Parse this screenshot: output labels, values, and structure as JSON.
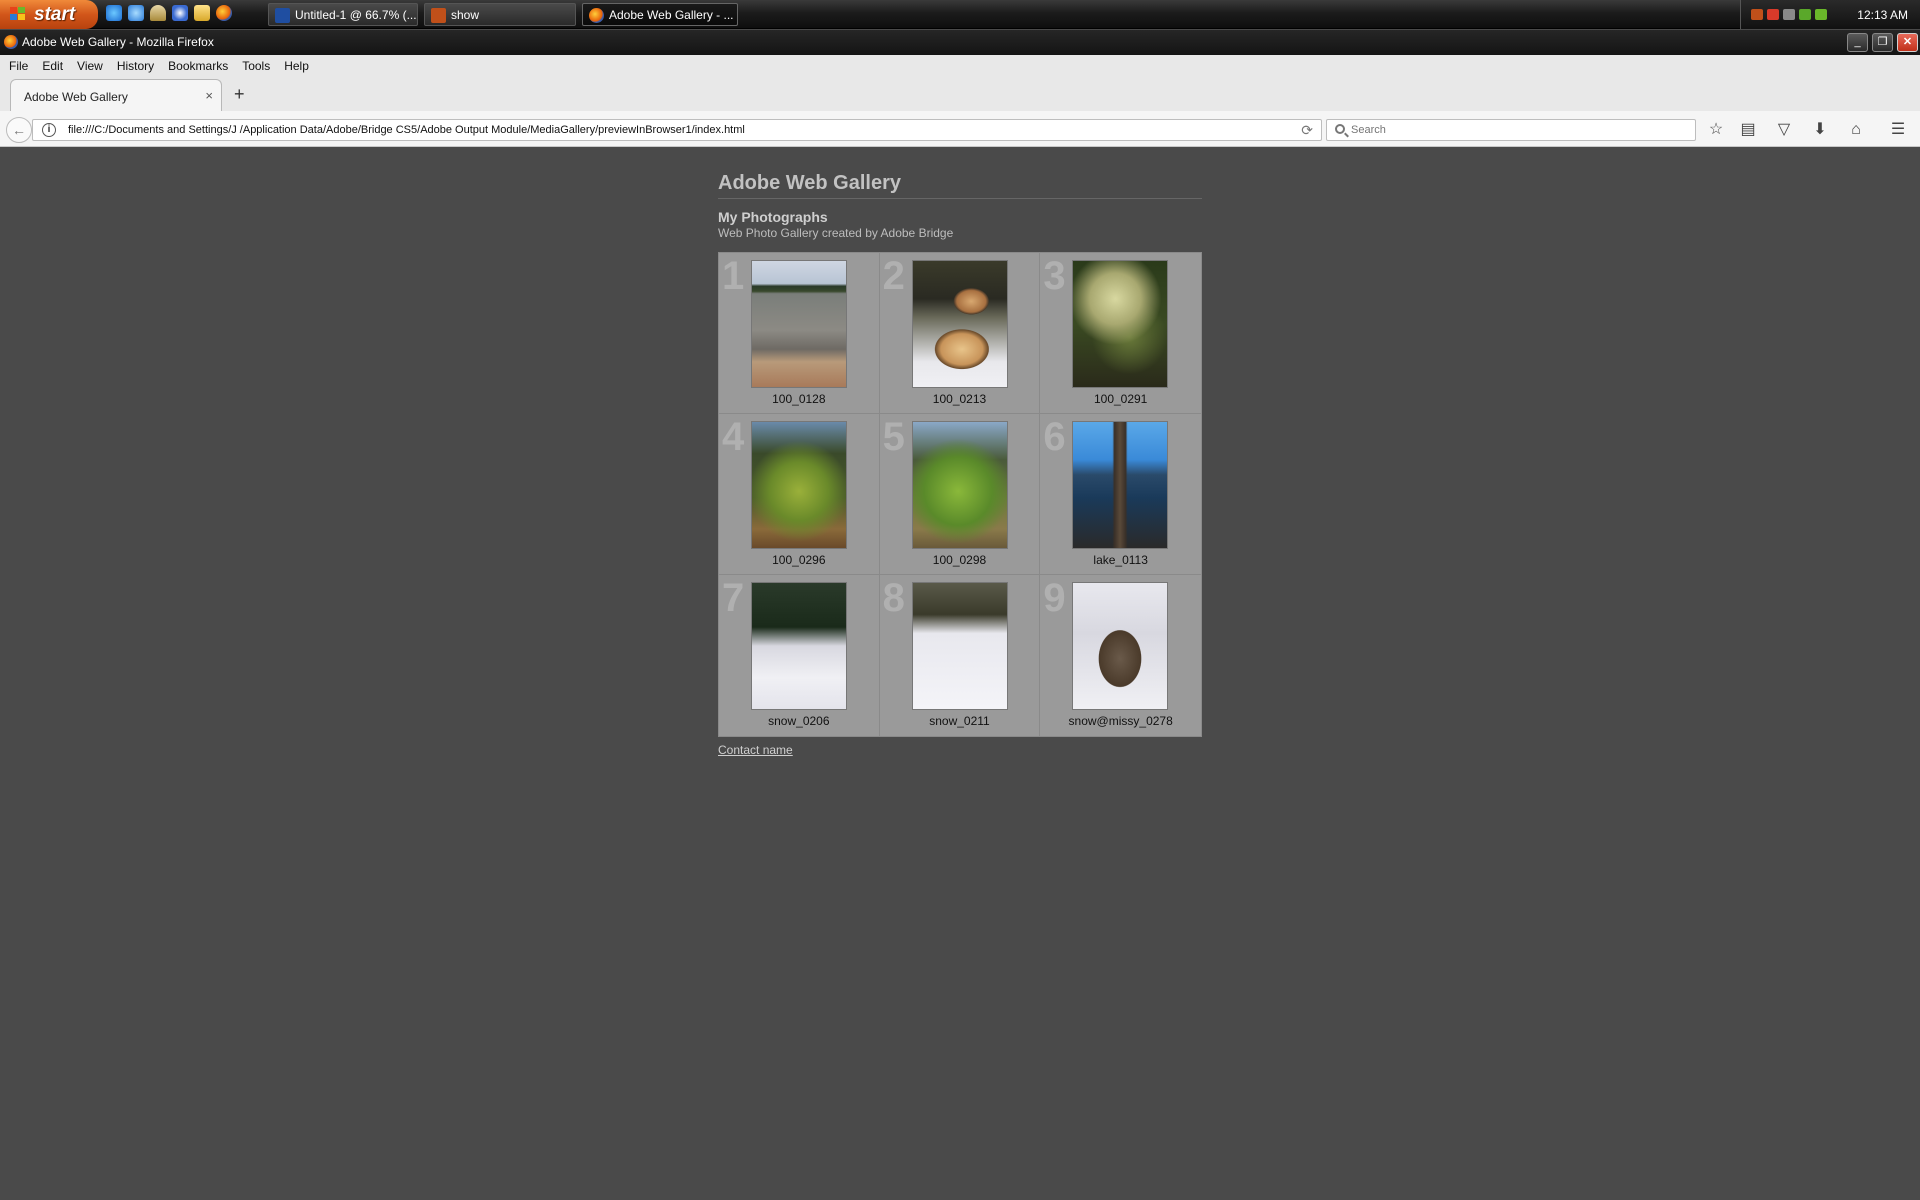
{
  "taskbar": {
    "start_label": "start",
    "tasks": [
      {
        "label": "Untitled-1 @ 66.7% (...",
        "icon": "photoshop-icon",
        "color": "#1f4ea1"
      },
      {
        "label": "show",
        "icon": "bridge-icon",
        "color": "#c0501a"
      },
      {
        "label": "Adobe Web Gallery - ...",
        "icon": "firefox-icon",
        "color": "#e8620b"
      }
    ],
    "clock": "12:13 AM"
  },
  "window": {
    "title": "Adobe Web Gallery - Mozilla Firefox",
    "minimize": "_",
    "restore": "❐",
    "close": "✕"
  },
  "menu": {
    "items": [
      "File",
      "Edit",
      "View",
      "History",
      "Bookmarks",
      "Tools",
      "Help"
    ]
  },
  "tabs": {
    "active_label": "Adobe Web Gallery",
    "close": "×",
    "new_tab": "+"
  },
  "navbar": {
    "url": "file:///C:/Documents and Settings/J     /Application Data/Adobe/Bridge CS5/Adobe Output Module/MediaGallery/previewInBrowser1/index.html",
    "search_placeholder": "Search"
  },
  "gallery": {
    "site_title": "Adobe Web Gallery",
    "gallery_name": "My Photographs",
    "description": "Web Photo Gallery created by Adobe Bridge",
    "contact": "Contact name",
    "photos": [
      {
        "num": "1",
        "caption": "100_0128"
      },
      {
        "num": "2",
        "caption": "100_0213"
      },
      {
        "num": "3",
        "caption": "100_0291"
      },
      {
        "num": "4",
        "caption": "100_0296"
      },
      {
        "num": "5",
        "caption": "100_0298"
      },
      {
        "num": "6",
        "caption": "lake_0113"
      },
      {
        "num": "7",
        "caption": "snow_0206"
      },
      {
        "num": "8",
        "caption": "snow_0211"
      },
      {
        "num": "9",
        "caption": "snow@missy_0278"
      }
    ]
  },
  "colors": {
    "page_bg": "#4a4a4a",
    "grid_bg": "#9a9a9a",
    "title_text": "#c2c2c2"
  }
}
